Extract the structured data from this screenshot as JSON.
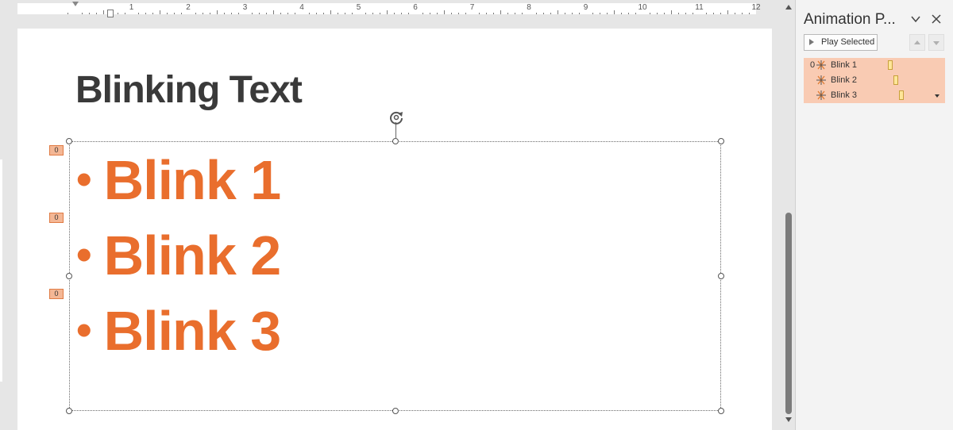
{
  "ruler": {
    "numbers": [
      "1",
      "2",
      "3",
      "4",
      "5",
      "6",
      "7",
      "8",
      "9",
      "10",
      "11",
      "12"
    ]
  },
  "slide": {
    "title": "Blinking Text",
    "bullets": [
      {
        "text": "Blink 1",
        "tag": "0"
      },
      {
        "text": "Blink 2",
        "tag": "0"
      },
      {
        "text": "Blink 3",
        "tag": "0"
      }
    ],
    "bullet_char": "•"
  },
  "pane": {
    "title": "Animation P...",
    "play_label": "Play Selected",
    "items": [
      {
        "num": "0",
        "name": "Blink 1"
      },
      {
        "num": "",
        "name": "Blink 2"
      },
      {
        "num": "",
        "name": "Blink 3"
      }
    ]
  },
  "colors": {
    "accent_text": "#e96e2d",
    "selection": "#f9cbb3",
    "timing_bar": "#ffe699"
  },
  "icons": {
    "rotate": "rotate-icon",
    "collapse": "chevron-down-icon",
    "close": "close-icon",
    "effect": "star-effect-icon"
  }
}
